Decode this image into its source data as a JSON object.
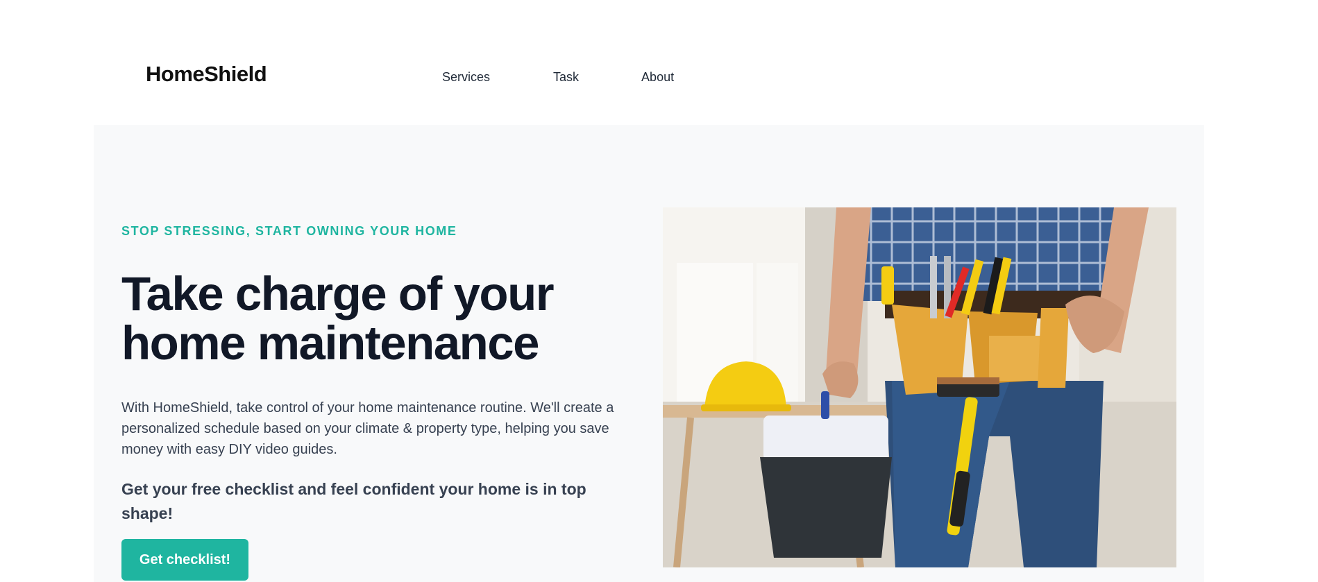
{
  "brand": {
    "name": "HomeShield"
  },
  "nav": {
    "items": [
      "Services",
      "Task",
      "About"
    ]
  },
  "hero": {
    "eyebrow": "STOP STRESSING, START OWNING YOUR HOME",
    "headline": "Take charge of your home maintenance",
    "description": "With HomeShield, take control of your home maintenance routine. We'll create a personalized schedule based on your climate & property type, helping you save money with easy DIY video guides.",
    "subheadline": "Get your free checklist and feel confident your home is in top shape!",
    "cta_label": "Get checklist!",
    "image_icon": "handyman-with-tool-belt-photo"
  },
  "colors": {
    "accent": "#1fb5a0",
    "headline": "#111827",
    "hero_bg": "#f8f9fa"
  }
}
